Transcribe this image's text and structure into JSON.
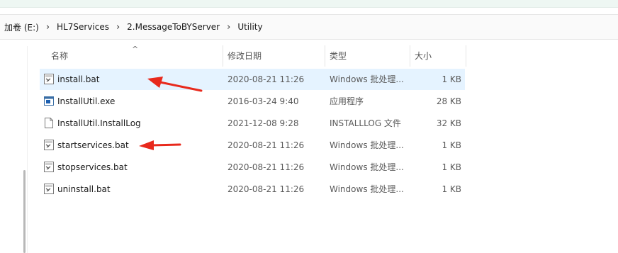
{
  "breadcrumb": [
    "加卷 (E:)",
    "HL7Services",
    "2.MessageToBYServer",
    "Utility"
  ],
  "columns": {
    "name": "名称",
    "date": "修改日期",
    "type": "类型",
    "size": "大小"
  },
  "sort_indicator": "^",
  "files": [
    {
      "name": "install.bat",
      "date": "2020-08-21 11:26",
      "type": "Windows 批处理...",
      "size": "1 KB",
      "icon": "batch-file-icon",
      "selected": true
    },
    {
      "name": "InstallUtil.exe",
      "date": "2016-03-24 9:40",
      "type": "应用程序",
      "size": "28 KB",
      "icon": "exe-file-icon",
      "selected": false
    },
    {
      "name": "InstallUtil.InstallLog",
      "date": "2021-12-08 9:28",
      "type": "INSTALLLOG 文件",
      "size": "32 KB",
      "icon": "blank-file-icon",
      "selected": false
    },
    {
      "name": "startservices.bat",
      "date": "2020-08-21 11:26",
      "type": "Windows 批处理...",
      "size": "1 KB",
      "icon": "batch-file-icon",
      "selected": false
    },
    {
      "name": "stopservices.bat",
      "date": "2020-08-21 11:26",
      "type": "Windows 批处理...",
      "size": "1 KB",
      "icon": "batch-file-icon",
      "selected": false
    },
    {
      "name": "uninstall.bat",
      "date": "2020-08-21 11:26",
      "type": "Windows 批处理...",
      "size": "1 KB",
      "icon": "batch-file-icon",
      "selected": false
    }
  ],
  "colors": {
    "selection": "#e5f3ff",
    "annotation_arrow": "#e8291c"
  }
}
